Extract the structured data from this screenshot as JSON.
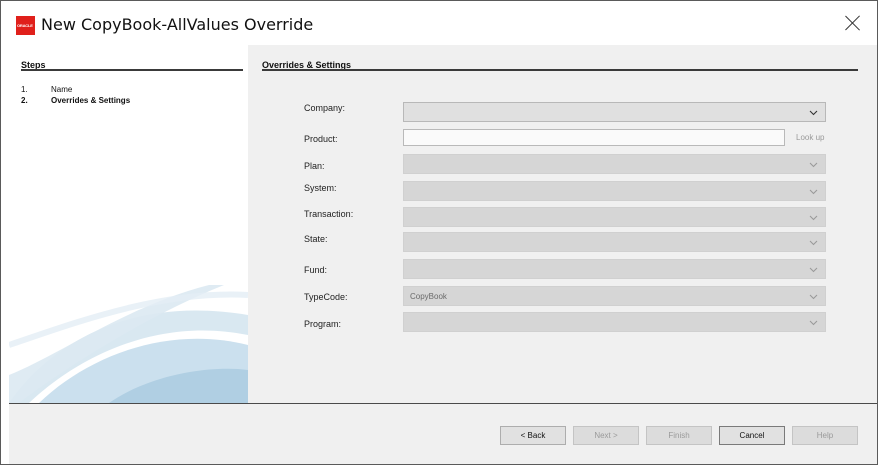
{
  "window": {
    "title": "New CopyBook-AllValues Override",
    "logo_text": "ORACLE"
  },
  "steps": {
    "heading": "Steps",
    "items": [
      {
        "num": "1.",
        "label": "Name"
      },
      {
        "num": "2.",
        "label": "Overrides & Settings"
      }
    ]
  },
  "overrides": {
    "heading": "Overrides & Settings",
    "fields": {
      "company": {
        "label": "Company:",
        "value": ""
      },
      "product": {
        "label": "Product:",
        "value": "",
        "lookup": "Look up"
      },
      "plan": {
        "label": "Plan:",
        "value": ""
      },
      "system": {
        "label": "System:",
        "value": ""
      },
      "transaction": {
        "label": "Transaction:",
        "value": ""
      },
      "state": {
        "label": "State:",
        "value": ""
      },
      "fund": {
        "label": "Fund:",
        "value": ""
      },
      "typecode": {
        "label": "TypeCode:",
        "value": "CopyBook"
      },
      "program": {
        "label": "Program:",
        "value": ""
      }
    }
  },
  "footer": {
    "back": "< Back",
    "next": "Next >",
    "finish": "Finish",
    "cancel": "Cancel",
    "help": "Help"
  },
  "colors": {
    "accent": "#e0201b",
    "panel": "#f0f0f0",
    "swoosh": "#a9cbe0"
  }
}
